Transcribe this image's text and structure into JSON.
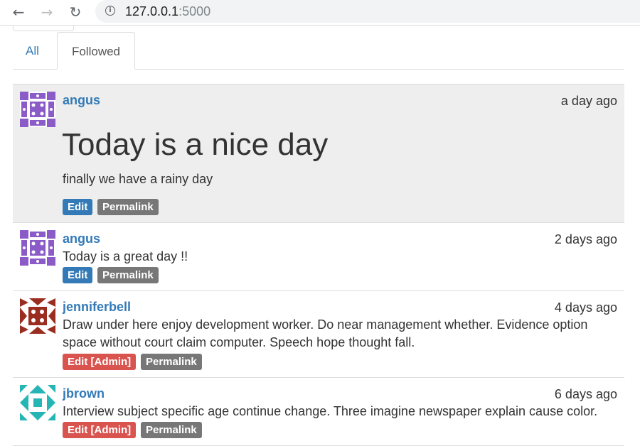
{
  "browser": {
    "back_icon": "arrow-left-icon",
    "forward_icon": "arrow-right-icon",
    "reload_icon": "reload-icon",
    "info_icon": "info-icon",
    "url_host": "127.0.0.1",
    "url_port": ":5000"
  },
  "tabs": [
    {
      "label": "All",
      "active": false
    },
    {
      "label": "Followed",
      "active": true
    }
  ],
  "posts": [
    {
      "author": "angus",
      "time": "a day ago",
      "title": "Today is a nice day",
      "body": "finally we have a rainy day",
      "edit_label": "Edit",
      "permalink_label": "Permalink",
      "avatar_color": "#8b5cc7"
    },
    {
      "author": "angus",
      "time": "2 days ago",
      "body": "Today is a great day !!",
      "edit_label": "Edit",
      "permalink_label": "Permalink",
      "avatar_color": "#8b5cc7"
    },
    {
      "author": "jenniferbell",
      "time": "4 days ago",
      "body": "Draw under here enjoy development worker. Do near management whether. Evidence option space without court claim computer. Speech hope thought fall.",
      "edit_label": "Edit [Admin]",
      "permalink_label": "Permalink",
      "avatar_color": "#9b2d20"
    },
    {
      "author": "jbrown",
      "time": "6 days ago",
      "body": "Interview subject specific age continue change. Three imagine newspaper explain cause color.",
      "edit_label": "Edit [Admin]",
      "permalink_label": "Permalink",
      "avatar_color": "#26b5b5"
    }
  ],
  "colors": {
    "link": "#337ab7",
    "admin": "#d9534f",
    "permalink": "#777777",
    "highlight_bg": "#eeeeee"
  }
}
